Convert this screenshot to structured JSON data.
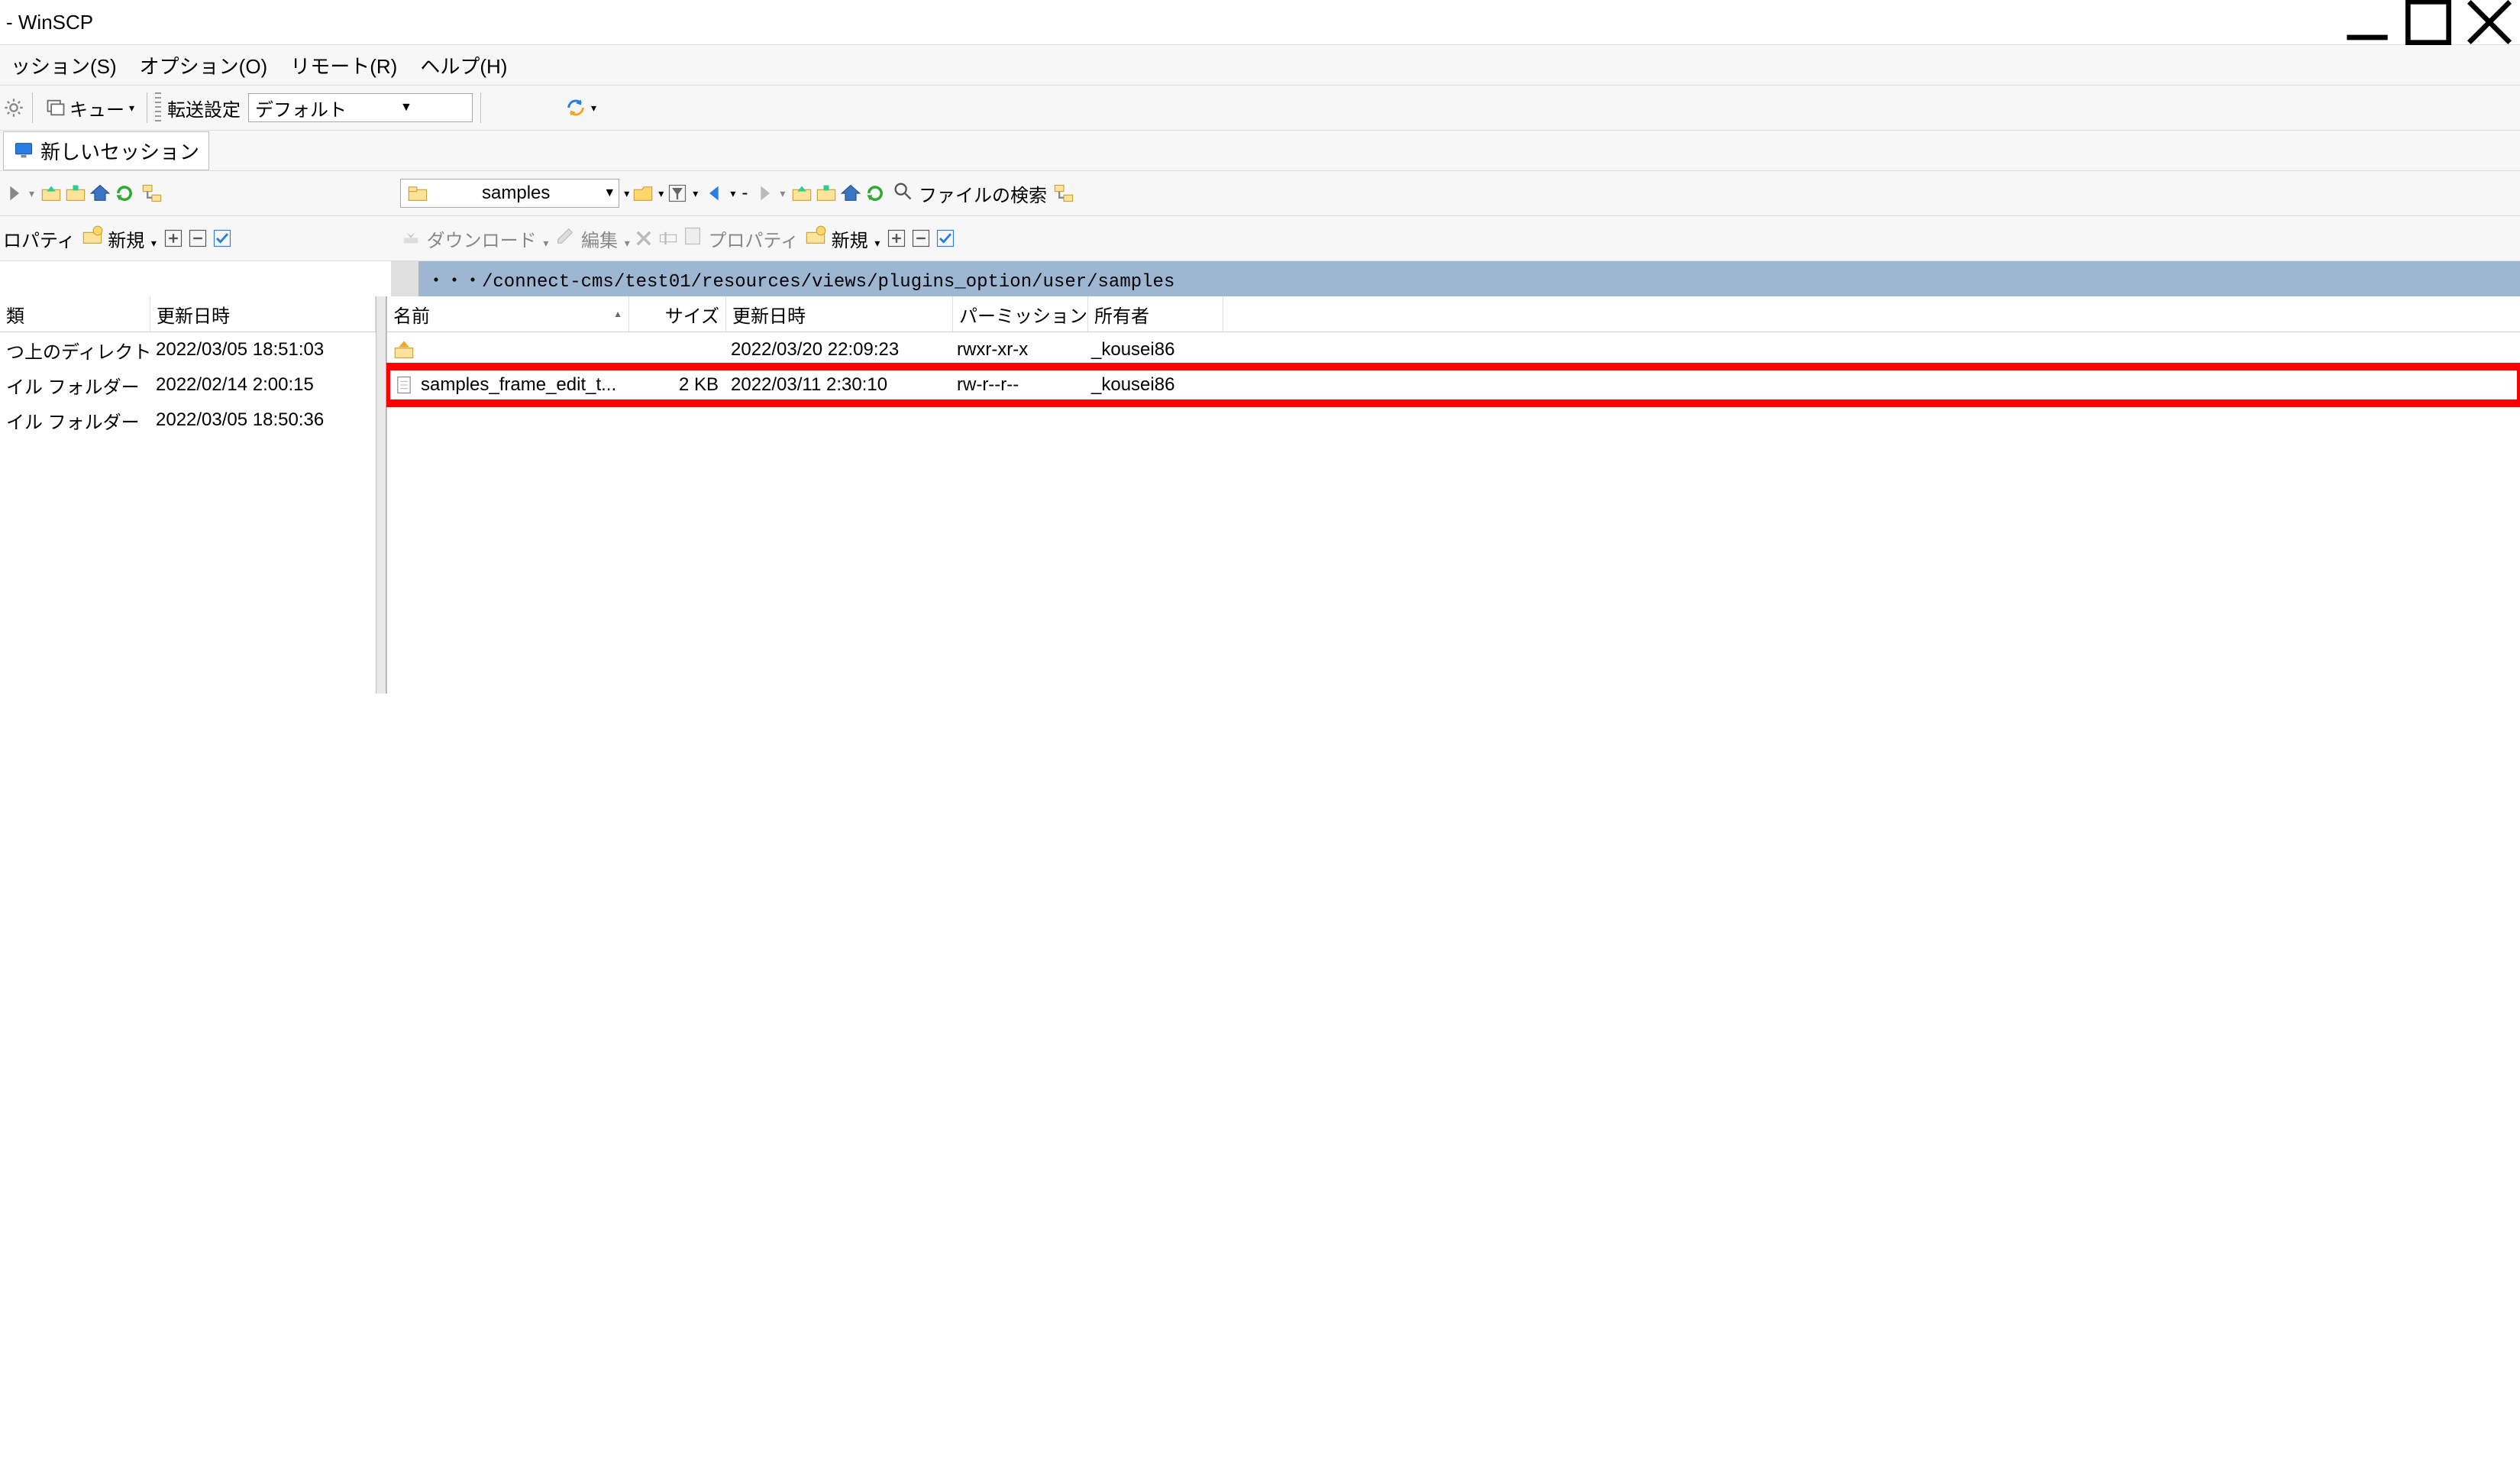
{
  "title": " - WinSCP",
  "menubar": {
    "items": [
      "ッション(S)",
      "オプション(O)",
      "リモート(R)",
      "ヘルプ(H)"
    ]
  },
  "toolbar1": {
    "queue_label": "キュー",
    "transfer_label": "転送設定",
    "transfer_value": "デフォルト"
  },
  "tab": {
    "new_session_label": "新しいセッション"
  },
  "nav": {
    "right_folder": "samples",
    "search_label": "ファイルの検索"
  },
  "sub": {
    "properties_label": "ロパティ",
    "new_label_left": "新規",
    "download_label": "ダウンロード",
    "edit_label": "編集",
    "properties_label_right": "プロパティ",
    "new_label_right": "新規"
  },
  "path": {
    "right": "・・・/connect-cms/test01/resources/views/plugins_option/user/samples"
  },
  "left": {
    "headers": [
      "類",
      "更新日時"
    ],
    "rows": [
      {
        "type": "つ上のディレクトリ",
        "mtime": "2022/03/05 18:51:03"
      },
      {
        "type": "イル フォルダー",
        "mtime": "2022/02/14 2:00:15"
      },
      {
        "type": "イル フォルダー",
        "mtime": "2022/03/05 18:50:36"
      }
    ]
  },
  "right": {
    "headers": [
      "名前",
      "サイズ",
      "更新日時",
      "パーミッション",
      "所有者"
    ],
    "rows": [
      {
        "name": "..",
        "size": "",
        "mtime": "2022/03/20 22:09:23",
        "perm": "rwxr-xr-x",
        "owner": "_kousei86",
        "icon": "up"
      },
      {
        "name": "samples_frame_edit_t...",
        "size": "2 KB",
        "mtime": "2022/03/11 2:30:10",
        "perm": "rw-r--r--",
        "owner": "_kousei86",
        "icon": "file",
        "highlight": true
      }
    ]
  }
}
